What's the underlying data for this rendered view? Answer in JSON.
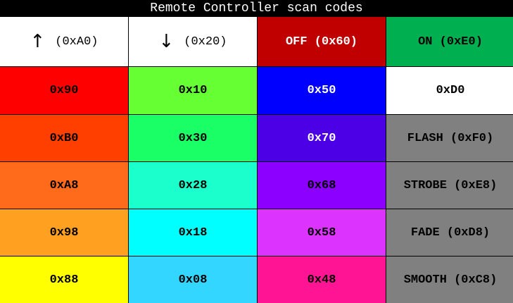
{
  "title": "Remote Controller scan codes",
  "header": [
    {
      "icon": "up-arrow-icon",
      "glyph": "↑",
      "label": "(0xA0)",
      "bg": "#ffffff",
      "fg": "#000000"
    },
    {
      "icon": "down-arrow-icon",
      "glyph": "↓",
      "label": "(0x20)",
      "bg": "#ffffff",
      "fg": "#000000"
    },
    {
      "label": "OFF (0x60)",
      "bg": "#c00000",
      "fg": "#ffffff"
    },
    {
      "label": "ON (0xE0)",
      "bg": "#00b050",
      "fg": "#000000"
    }
  ],
  "rows": [
    [
      {
        "label": "0x90",
        "bg": "#ff0000",
        "fg": "#000000"
      },
      {
        "label": "0x10",
        "bg": "#66ff33",
        "fg": "#000000"
      },
      {
        "label": "0x50",
        "bg": "#0000ff",
        "fg": "#ffffff"
      },
      {
        "label": "0xD0",
        "bg": "#ffffff",
        "fg": "#000000"
      }
    ],
    [
      {
        "label": "0xB0",
        "bg": "#ff3f00",
        "fg": "#000000"
      },
      {
        "label": "0x30",
        "bg": "#1aff66",
        "fg": "#000000"
      },
      {
        "label": "0x70",
        "bg": "#4b00e6",
        "fg": "#ffffff"
      },
      {
        "label": "FLASH (0xF0)",
        "bg": "#808080",
        "fg": "#000000"
      }
    ],
    [
      {
        "label": "0xA8",
        "bg": "#ff6b1a",
        "fg": "#000000"
      },
      {
        "label": "0x28",
        "bg": "#1affcc",
        "fg": "#000000"
      },
      {
        "label": "0x68",
        "bg": "#8c00ff",
        "fg": "#000000"
      },
      {
        "label": "STROBE (0xE8)",
        "bg": "#808080",
        "fg": "#000000"
      }
    ],
    [
      {
        "label": "0x98",
        "bg": "#ffa020",
        "fg": "#000000"
      },
      {
        "label": "0x18",
        "bg": "#00ffff",
        "fg": "#000000"
      },
      {
        "label": "0x58",
        "bg": "#dd33ff",
        "fg": "#000000"
      },
      {
        "label": "FADE (0xD8)",
        "bg": "#808080",
        "fg": "#000000"
      }
    ],
    [
      {
        "label": "0x88",
        "bg": "#ffff00",
        "fg": "#000000"
      },
      {
        "label": "0x08",
        "bg": "#33d6ff",
        "fg": "#000000"
      },
      {
        "label": "0x48",
        "bg": "#ff1493",
        "fg": "#000000"
      },
      {
        "label": "SMOOTH (0xC8)",
        "bg": "#808080",
        "fg": "#000000"
      }
    ]
  ]
}
